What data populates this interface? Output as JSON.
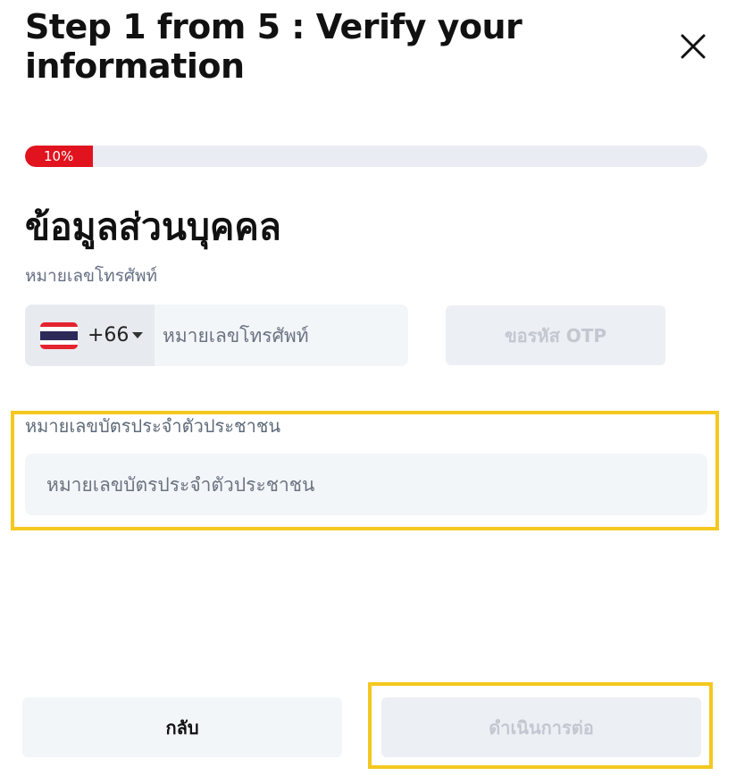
{
  "header": {
    "title": "Step 1 from 5 : Verify your information",
    "close_icon": "close-icon"
  },
  "progress": {
    "label": "10%",
    "fraction": 0.1,
    "fill_color": "#e1131f",
    "track_color": "#e9ecf2"
  },
  "section": {
    "heading": "ข้อมูลส่วนบุคคล"
  },
  "phone": {
    "label": "หมายเลขโทรศัพท์",
    "country_flag": "thailand-flag-icon",
    "dial_code": "+66",
    "caret_icon": "caret-down-icon",
    "placeholder": "หมายเลขโทรศัพท์",
    "value": "",
    "otp_button": "ขอรหัส OTP"
  },
  "id_card": {
    "label": "หมายเลขบัตรประจำตัวประชาชน",
    "placeholder": "หมายเลขบัตรประจำตัวประชาชน",
    "value": ""
  },
  "footer": {
    "back_button": "กลับ",
    "next_button": "ดำเนินการต่อ"
  },
  "colors": {
    "highlight": "#f4c81e",
    "disabled_text": "#c3c8d0",
    "field_bg": "#f3f6f9"
  }
}
